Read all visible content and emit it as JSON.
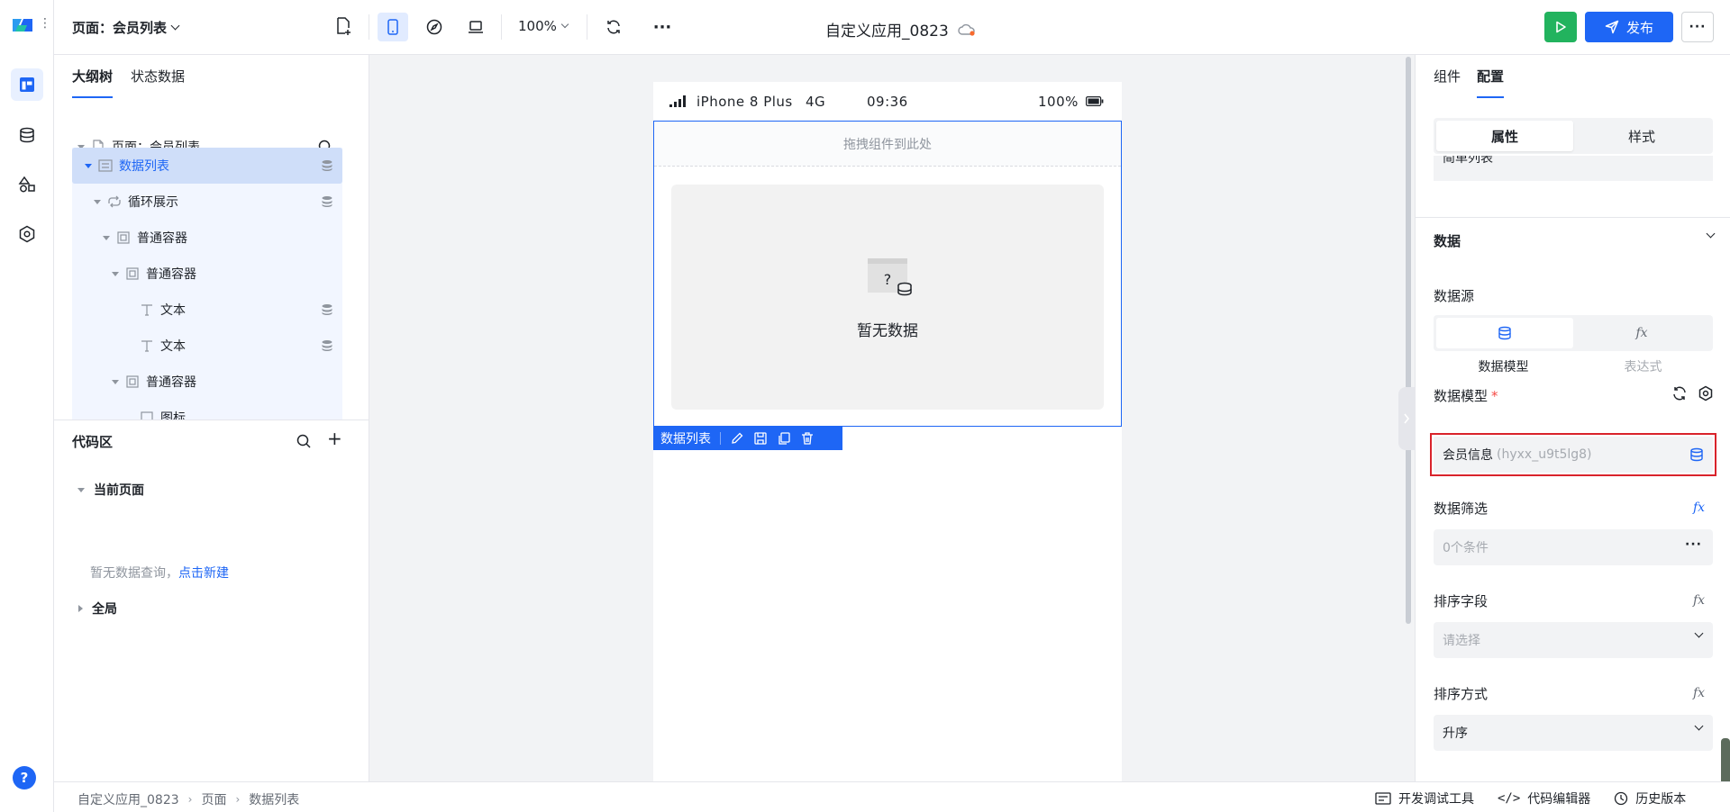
{
  "topbar": {
    "page_selector": "页面：会员列表",
    "zoom": "100%",
    "app_title": "自定义应用_0823",
    "publish_label": "发布"
  },
  "left_panel": {
    "tabs": [
      "大纲树",
      "状态数据"
    ],
    "tree": [
      {
        "label": "页面：会员列表",
        "icon": "page-icon",
        "has_db": false
      },
      {
        "label": "数据列表",
        "icon": "list-icon",
        "has_db": true,
        "selected": true
      },
      {
        "label": "循环展示",
        "icon": "loop-icon",
        "has_db": true
      },
      {
        "label": "普通容器",
        "icon": "container-icon",
        "has_db": false
      },
      {
        "label": "普通容器",
        "icon": "container-icon",
        "has_db": false
      },
      {
        "label": "文本",
        "icon": "text-icon",
        "has_db": true
      },
      {
        "label": "文本",
        "icon": "text-icon",
        "has_db": true
      },
      {
        "label": "普通容器",
        "icon": "container-icon",
        "has_db": false
      },
      {
        "label": "图标",
        "icon": "image-icon",
        "has_db": false
      }
    ],
    "code_area": {
      "title": "代码区",
      "current_page": "当前页面",
      "empty_text": "暂无数据查询，",
      "create_link": "点击新建",
      "global": "全局"
    }
  },
  "canvas": {
    "status_bar": {
      "device": "iPhone 8 Plus",
      "network": "4G",
      "time": "09:36",
      "battery": "100%"
    },
    "drop_hint": "拖拽组件到此处",
    "empty_text": "暂无数据",
    "placeholder_mark": "?",
    "selection_label": "数据列表"
  },
  "right_panel": {
    "tabs": [
      "组件",
      "配置"
    ],
    "segment": [
      "属性",
      "样式"
    ],
    "peek_value": "简单列表",
    "section_title": "数据",
    "datasource_label": "数据源",
    "datasource_options": [
      "数据模型",
      "表达式"
    ],
    "model_label": "数据模型",
    "model_required_mark": "*",
    "model_name": "会员信息",
    "model_id": "(hyxx_u9t5lg8)",
    "filter_label": "数据筛选",
    "filter_value": "0个条件",
    "sort_field_label": "排序字段",
    "sort_field_placeholder": "请选择",
    "sort_order_label": "排序方式",
    "sort_order_value": "升序",
    "fx_symbol": "fx"
  },
  "bottombar": {
    "breadcrumb": [
      "自定义应用_0823",
      "页面",
      "数据列表"
    ],
    "tools": [
      "开发调试工具",
      "代码编辑器",
      "历史版本"
    ]
  },
  "colors": {
    "primary": "#1e66f5",
    "run": "#22b35e",
    "highlight_frame": "#d9232b"
  }
}
